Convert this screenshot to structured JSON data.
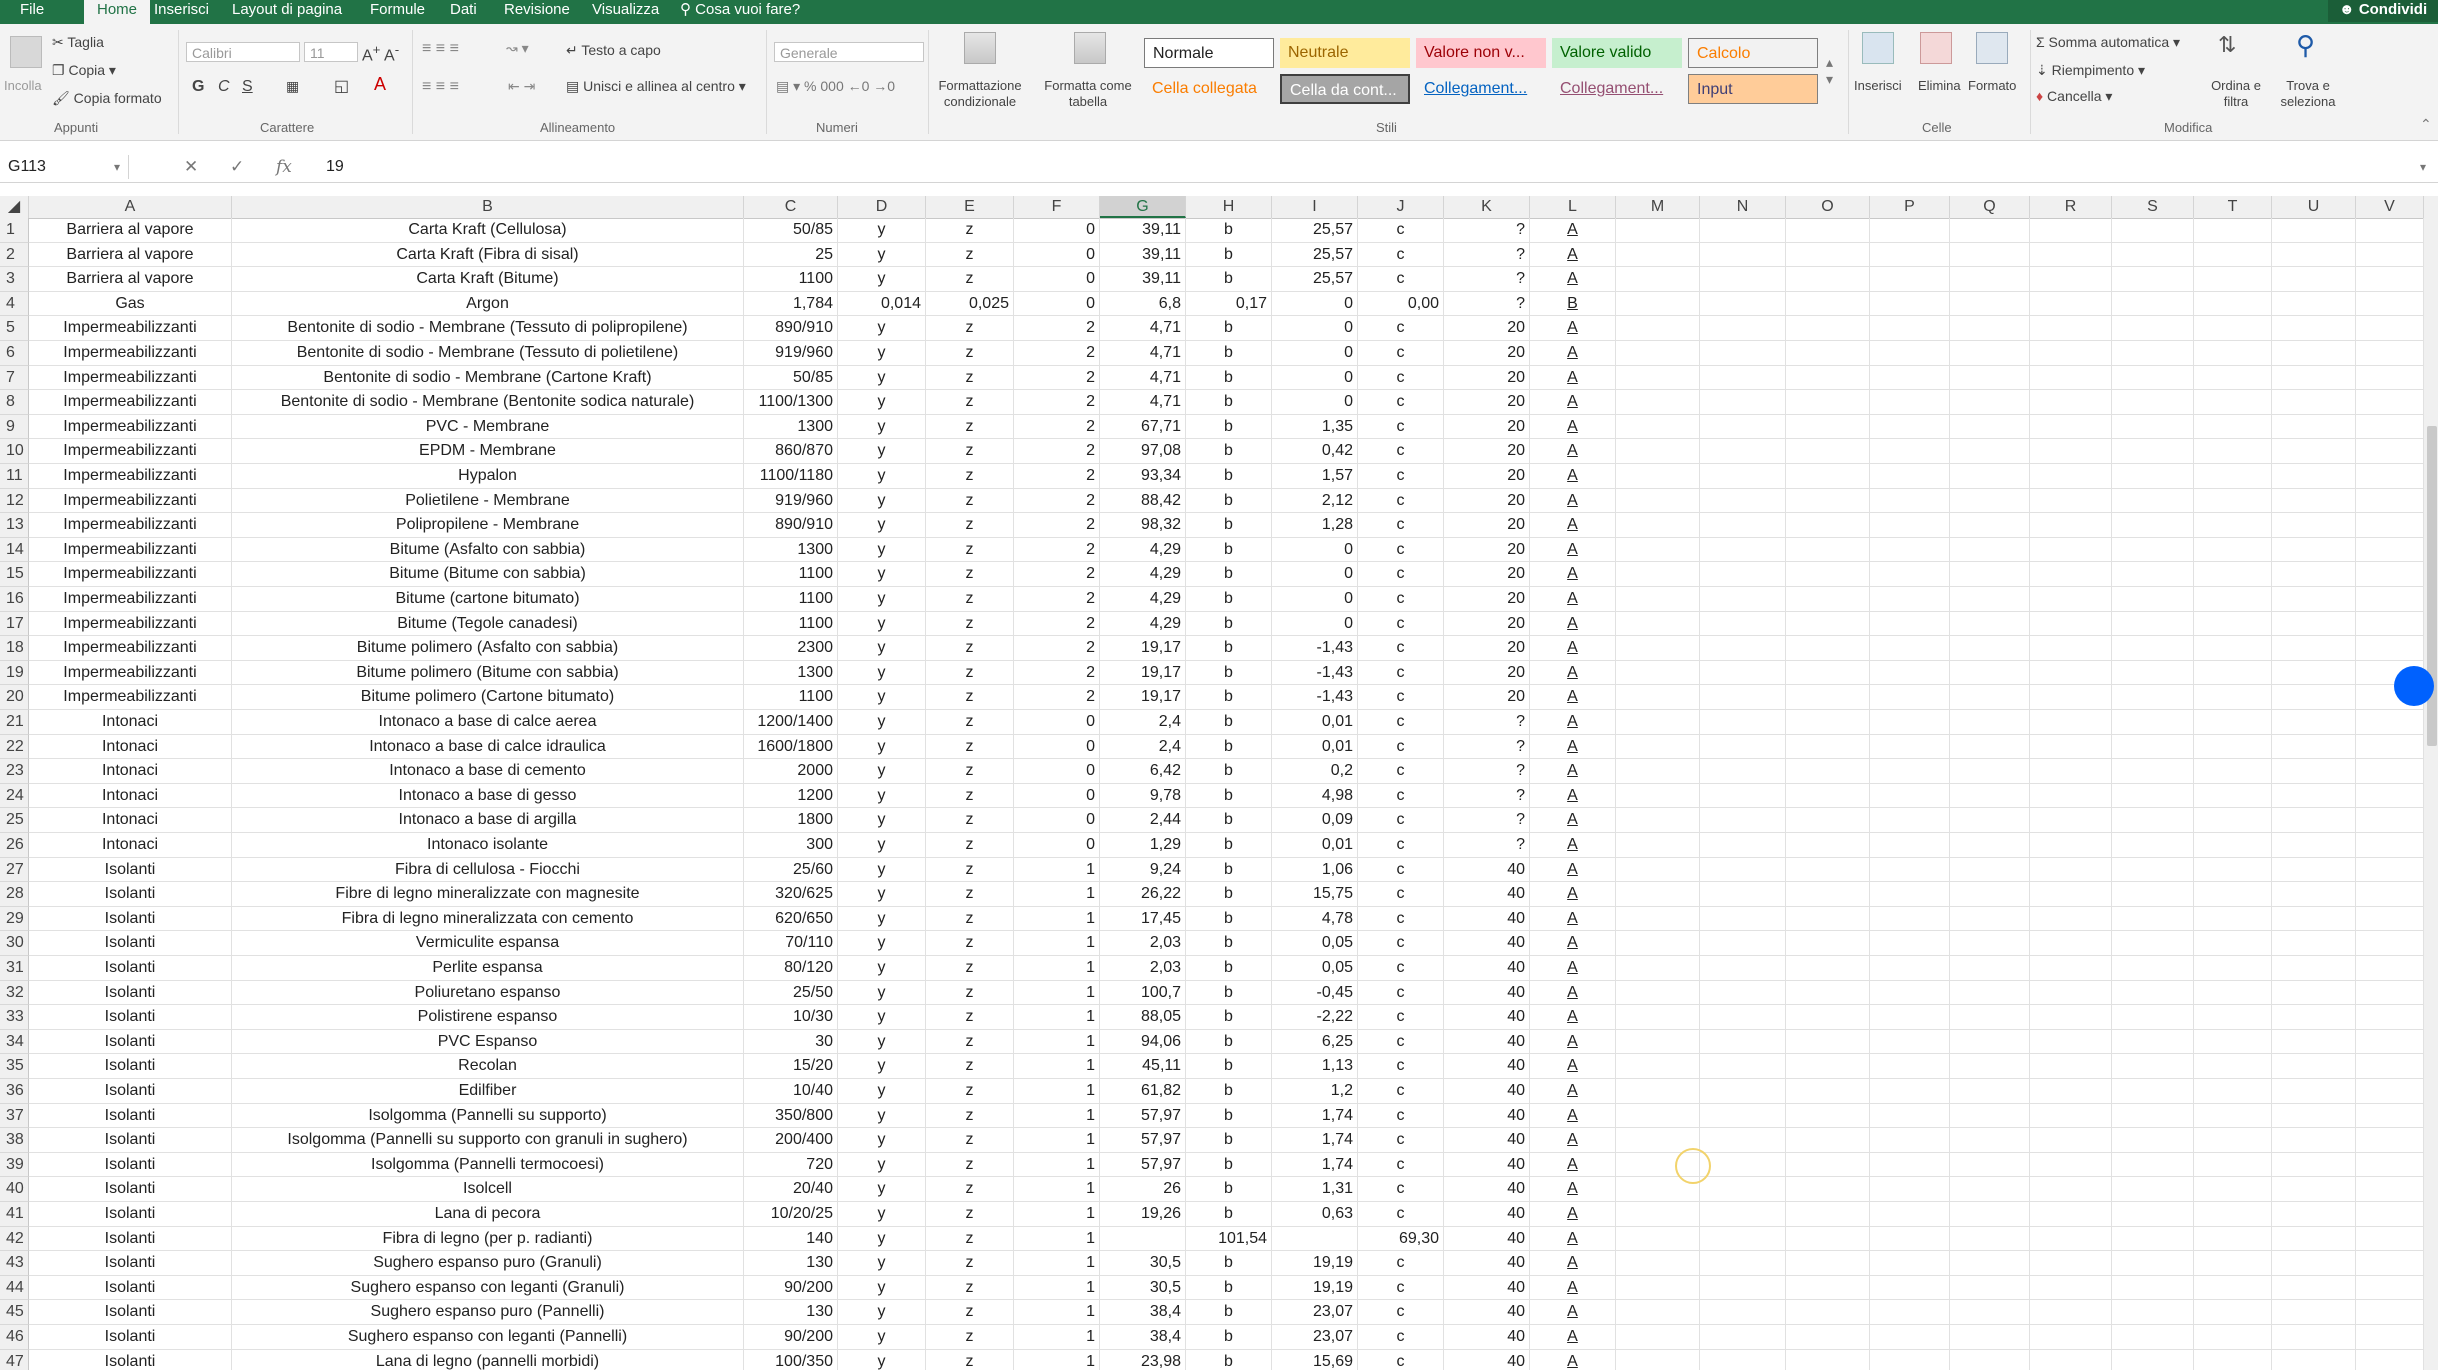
{
  "tabs": [
    "File",
    "Home",
    "Inserisci",
    "Layout di pagina",
    "Formule",
    "Dati",
    "Revisione",
    "Visualizza"
  ],
  "active_tab": "Home",
  "tell_me": "Cosa vuoi fare?",
  "share_label": "Condividi",
  "ribbon": {
    "clipboard": {
      "paste": "Incolla",
      "cut": "Taglia",
      "copy": "Copia",
      "format_painter": "Copia formato",
      "label": "Appunti"
    },
    "font": {
      "name": "Calibri",
      "size": "11",
      "bold": "G",
      "italic": "C",
      "underline": "S",
      "label": "Carattere"
    },
    "alignment": {
      "wrap": "Testo a capo",
      "merge": "Unisci e allinea al centro",
      "label": "Allineamento"
    },
    "number": {
      "format": "Generale",
      "label": "Numeri"
    },
    "styles": {
      "conditional": "Formattazione condizionale",
      "as_table": "Formatta come tabella",
      "cells": [
        "Normale",
        "Neutrale",
        "Valore non v...",
        "Valore valido",
        "Calcolo",
        "Cella collegata",
        "Cella da cont...",
        "Collegament...",
        "Collegament...",
        "Input"
      ],
      "label": "Stili"
    },
    "cells": {
      "insert": "Inserisci",
      "delete": "Elimina",
      "format": "Formato",
      "label": "Celle"
    },
    "editing": {
      "autosum": "Somma automatica",
      "fill": "Riempimento",
      "clear": "Cancella",
      "sort": "Ordina e filtra",
      "find": "Trova e seleziona",
      "label": "Modifica"
    },
    "colors": {
      "neutral_bg": "#ffeb9c",
      "bad_bg": "#ffc7ce",
      "good_bg": "#c6efce",
      "calc_bg": "#f2f2f2",
      "check_bg": "#a5a5a5",
      "input_bg": "#ffcc99"
    }
  },
  "formula_bar": {
    "name_box": "G113",
    "value": "19"
  },
  "columns": [
    "A",
    "B",
    "C",
    "D",
    "E",
    "F",
    "G",
    "H",
    "I",
    "J",
    "K",
    "L",
    "M",
    "N",
    "O",
    "P",
    "Q",
    "R",
    "S",
    "T",
    "U",
    "V"
  ],
  "selected_column": "G",
  "rows": [
    [
      "1",
      "Barriera al vapore",
      "Carta Kraft (Cellulosa)",
      "50/85",
      "y",
      "z",
      "0",
      "39,11",
      "b",
      "25,57",
      "c",
      "?",
      "A"
    ],
    [
      "2",
      "Barriera al vapore",
      "Carta Kraft (Fibra di sisal)",
      "25",
      "y",
      "z",
      "0",
      "39,11",
      "b",
      "25,57",
      "c",
      "?",
      "A"
    ],
    [
      "3",
      "Barriera al vapore",
      "Carta Kraft (Bitume)",
      "1100",
      "y",
      "z",
      "0",
      "39,11",
      "b",
      "25,57",
      "c",
      "?",
      "A"
    ],
    [
      "4",
      "Gas",
      "Argon",
      "1,784",
      "0,014",
      "0,025",
      "0",
      "6,8",
      "0,17",
      "0",
      "0,00",
      "?",
      "B"
    ],
    [
      "5",
      "Impermeabilizzanti",
      "Bentonite di sodio - Membrane (Tessuto di polipropilene)",
      "890/910",
      "y",
      "z",
      "2",
      "4,71",
      "b",
      "0",
      "c",
      "20",
      "A"
    ],
    [
      "6",
      "Impermeabilizzanti",
      "Bentonite di sodio - Membrane (Tessuto di polietilene)",
      "919/960",
      "y",
      "z",
      "2",
      "4,71",
      "b",
      "0",
      "c",
      "20",
      "A"
    ],
    [
      "7",
      "Impermeabilizzanti",
      "Bentonite di sodio - Membrane (Cartone Kraft)",
      "50/85",
      "y",
      "z",
      "2",
      "4,71",
      "b",
      "0",
      "c",
      "20",
      "A"
    ],
    [
      "8",
      "Impermeabilizzanti",
      "Bentonite di sodio - Membrane (Bentonite sodica naturale)",
      "1100/1300",
      "y",
      "z",
      "2",
      "4,71",
      "b",
      "0",
      "c",
      "20",
      "A"
    ],
    [
      "9",
      "Impermeabilizzanti",
      "PVC - Membrane",
      "1300",
      "y",
      "z",
      "2",
      "67,71",
      "b",
      "1,35",
      "c",
      "20",
      "A"
    ],
    [
      "10",
      "Impermeabilizzanti",
      "EPDM - Membrane",
      "860/870",
      "y",
      "z",
      "2",
      "97,08",
      "b",
      "0,42",
      "c",
      "20",
      "A"
    ],
    [
      "11",
      "Impermeabilizzanti",
      "Hypalon",
      "1100/1180",
      "y",
      "z",
      "2",
      "93,34",
      "b",
      "1,57",
      "c",
      "20",
      "A"
    ],
    [
      "12",
      "Impermeabilizzanti",
      "Polietilene - Membrane",
      "919/960",
      "y",
      "z",
      "2",
      "88,42",
      "b",
      "2,12",
      "c",
      "20",
      "A"
    ],
    [
      "13",
      "Impermeabilizzanti",
      "Polipropilene - Membrane",
      "890/910",
      "y",
      "z",
      "2",
      "98,32",
      "b",
      "1,28",
      "c",
      "20",
      "A"
    ],
    [
      "14",
      "Impermeabilizzanti",
      "Bitume (Asfalto con sabbia)",
      "1300",
      "y",
      "z",
      "2",
      "4,29",
      "b",
      "0",
      "c",
      "20",
      "A"
    ],
    [
      "15",
      "Impermeabilizzanti",
      "Bitume (Bitume con sabbia)",
      "1100",
      "y",
      "z",
      "2",
      "4,29",
      "b",
      "0",
      "c",
      "20",
      "A"
    ],
    [
      "16",
      "Impermeabilizzanti",
      "Bitume (cartone bitumato)",
      "1100",
      "y",
      "z",
      "2",
      "4,29",
      "b",
      "0",
      "c",
      "20",
      "A"
    ],
    [
      "17",
      "Impermeabilizzanti",
      "Bitume (Tegole canadesi)",
      "1100",
      "y",
      "z",
      "2",
      "4,29",
      "b",
      "0",
      "c",
      "20",
      "A"
    ],
    [
      "18",
      "Impermeabilizzanti",
      "Bitume polimero (Asfalto con sabbia)",
      "2300",
      "y",
      "z",
      "2",
      "19,17",
      "b",
      "-1,43",
      "c",
      "20",
      "A"
    ],
    [
      "19",
      "Impermeabilizzanti",
      "Bitume polimero (Bitume con sabbia)",
      "1300",
      "y",
      "z",
      "2",
      "19,17",
      "b",
      "-1,43",
      "c",
      "20",
      "A"
    ],
    [
      "20",
      "Impermeabilizzanti",
      "Bitume polimero (Cartone bitumato)",
      "1100",
      "y",
      "z",
      "2",
      "19,17",
      "b",
      "-1,43",
      "c",
      "20",
      "A"
    ],
    [
      "21",
      "Intonaci",
      "Intonaco a base di calce aerea",
      "1200/1400",
      "y",
      "z",
      "0",
      "2,4",
      "b",
      "0,01",
      "c",
      "?",
      "A"
    ],
    [
      "22",
      "Intonaci",
      "Intonaco a base di calce idraulica",
      "1600/1800",
      "y",
      "z",
      "0",
      "2,4",
      "b",
      "0,01",
      "c",
      "?",
      "A"
    ],
    [
      "23",
      "Intonaci",
      "Intonaco a base di cemento",
      "2000",
      "y",
      "z",
      "0",
      "6,42",
      "b",
      "0,2",
      "c",
      "?",
      "A"
    ],
    [
      "24",
      "Intonaci",
      "Intonaco a base di gesso",
      "1200",
      "y",
      "z",
      "0",
      "9,78",
      "b",
      "4,98",
      "c",
      "?",
      "A"
    ],
    [
      "25",
      "Intonaci",
      "Intonaco a base di argilla",
      "1800",
      "y",
      "z",
      "0",
      "2,44",
      "b",
      "0,09",
      "c",
      "?",
      "A"
    ],
    [
      "26",
      "Intonaci",
      "Intonaco isolante",
      "300",
      "y",
      "z",
      "0",
      "1,29",
      "b",
      "0,01",
      "c",
      "?",
      "A"
    ],
    [
      "27",
      "Isolanti",
      "Fibra di cellulosa - Fiocchi",
      "25/60",
      "y",
      "z",
      "1",
      "9,24",
      "b",
      "1,06",
      "c",
      "40",
      "A"
    ],
    [
      "28",
      "Isolanti",
      "Fibre di legno mineralizzate con magnesite",
      "320/625",
      "y",
      "z",
      "1",
      "26,22",
      "b",
      "15,75",
      "c",
      "40",
      "A"
    ],
    [
      "29",
      "Isolanti",
      "Fibra di legno mineralizzata con cemento",
      "620/650",
      "y",
      "z",
      "1",
      "17,45",
      "b",
      "4,78",
      "c",
      "40",
      "A"
    ],
    [
      "30",
      "Isolanti",
      "Vermiculite espansa",
      "70/110",
      "y",
      "z",
      "1",
      "2,03",
      "b",
      "0,05",
      "c",
      "40",
      "A"
    ],
    [
      "31",
      "Isolanti",
      "Perlite espansa",
      "80/120",
      "y",
      "z",
      "1",
      "2,03",
      "b",
      "0,05",
      "c",
      "40",
      "A"
    ],
    [
      "32",
      "Isolanti",
      "Poliuretano espanso",
      "25/50",
      "y",
      "z",
      "1",
      "100,7",
      "b",
      "-0,45",
      "c",
      "40",
      "A"
    ],
    [
      "33",
      "Isolanti",
      "Polistirene espanso",
      "10/30",
      "y",
      "z",
      "1",
      "88,05",
      "b",
      "-2,22",
      "c",
      "40",
      "A"
    ],
    [
      "34",
      "Isolanti",
      "PVC Espanso",
      "30",
      "y",
      "z",
      "1",
      "94,06",
      "b",
      "6,25",
      "c",
      "40",
      "A"
    ],
    [
      "35",
      "Isolanti",
      "Recolan",
      "15/20",
      "y",
      "z",
      "1",
      "45,11",
      "b",
      "1,13",
      "c",
      "40",
      "A"
    ],
    [
      "36",
      "Isolanti",
      "Edilfiber",
      "10/40",
      "y",
      "z",
      "1",
      "61,82",
      "b",
      "1,2",
      "c",
      "40",
      "A"
    ],
    [
      "37",
      "Isolanti",
      "Isolgomma (Pannelli su supporto)",
      "350/800",
      "y",
      "z",
      "1",
      "57,97",
      "b",
      "1,74",
      "c",
      "40",
      "A"
    ],
    [
      "38",
      "Isolanti",
      "Isolgomma (Pannelli su supporto con granuli in sughero)",
      "200/400",
      "y",
      "z",
      "1",
      "57,97",
      "b",
      "1,74",
      "c",
      "40",
      "A"
    ],
    [
      "39",
      "Isolanti",
      "Isolgomma (Pannelli termocoesi)",
      "720",
      "y",
      "z",
      "1",
      "57,97",
      "b",
      "1,74",
      "c",
      "40",
      "A"
    ],
    [
      "40",
      "Isolanti",
      "Isolcell",
      "20/40",
      "y",
      "z",
      "1",
      "26",
      "b",
      "1,31",
      "c",
      "40",
      "A"
    ],
    [
      "41",
      "Isolanti",
      "Lana di pecora",
      "10/20/25",
      "y",
      "z",
      "1",
      "19,26",
      "b",
      "0,63",
      "c",
      "40",
      "A"
    ],
    [
      "42",
      "Isolanti",
      "Fibra di legno (per p. radianti)",
      "140",
      "y",
      "z",
      "1",
      "",
      "101,54",
      "",
      "69,30",
      "40",
      "A"
    ],
    [
      "43",
      "Isolanti",
      "Sughero espanso puro (Granuli)",
      "130",
      "y",
      "z",
      "1",
      "30,5",
      "b",
      "19,19",
      "c",
      "40",
      "A"
    ],
    [
      "44",
      "Isolanti",
      "Sughero espanso con leganti (Granuli)",
      "90/200",
      "y",
      "z",
      "1",
      "30,5",
      "b",
      "19,19",
      "c",
      "40",
      "A"
    ],
    [
      "45",
      "Isolanti",
      "Sughero espanso puro (Pannelli)",
      "130",
      "y",
      "z",
      "1",
      "38,4",
      "b",
      "23,07",
      "c",
      "40",
      "A"
    ],
    [
      "46",
      "Isolanti",
      "Sughero espanso con leganti (Pannelli)",
      "90/200",
      "y",
      "z",
      "1",
      "38,4",
      "b",
      "23,07",
      "c",
      "40",
      "A"
    ],
    [
      "47",
      "Isolanti",
      "Lana di legno (pannelli morbidi)",
      "100/350",
      "y",
      "z",
      "1",
      "23,98",
      "b",
      "15,69",
      "c",
      "40",
      "A"
    ]
  ]
}
